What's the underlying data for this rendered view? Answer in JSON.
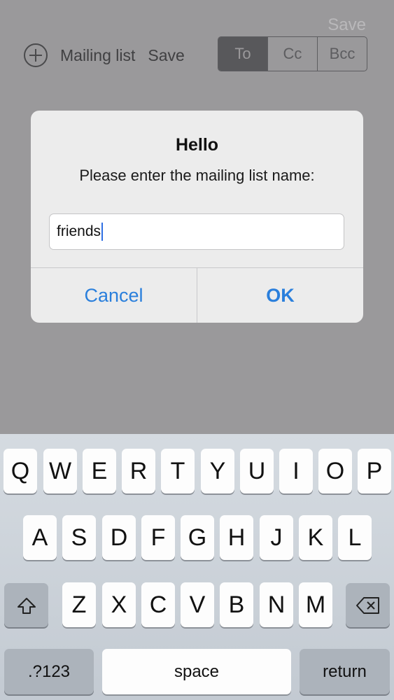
{
  "top": {
    "save_label": "Save"
  },
  "toolbar": {
    "mailing_list_label": "Mailing list",
    "save_label": "Save",
    "segments": [
      {
        "label": "To",
        "active": true
      },
      {
        "label": "Cc",
        "active": false
      },
      {
        "label": "Bcc",
        "active": false
      }
    ]
  },
  "alert": {
    "title": "Hello",
    "message": "Please enter the mailing list name:",
    "input_value": "friends",
    "cancel_label": "Cancel",
    "ok_label": "OK"
  },
  "keyboard": {
    "row1": [
      "Q",
      "W",
      "E",
      "R",
      "T",
      "Y",
      "U",
      "I",
      "O",
      "P"
    ],
    "row2": [
      "A",
      "S",
      "D",
      "F",
      "G",
      "H",
      "J",
      "K",
      "L"
    ],
    "row3": [
      "Z",
      "X",
      "C",
      "V",
      "B",
      "N",
      "M"
    ],
    "numbers_label": ".?123",
    "space_label": "space",
    "return_label": "return",
    "shift_icon": "shift-icon",
    "delete_icon": "delete-icon"
  },
  "colors": {
    "accent": "#2a7fdc",
    "background": "#9a999b"
  }
}
